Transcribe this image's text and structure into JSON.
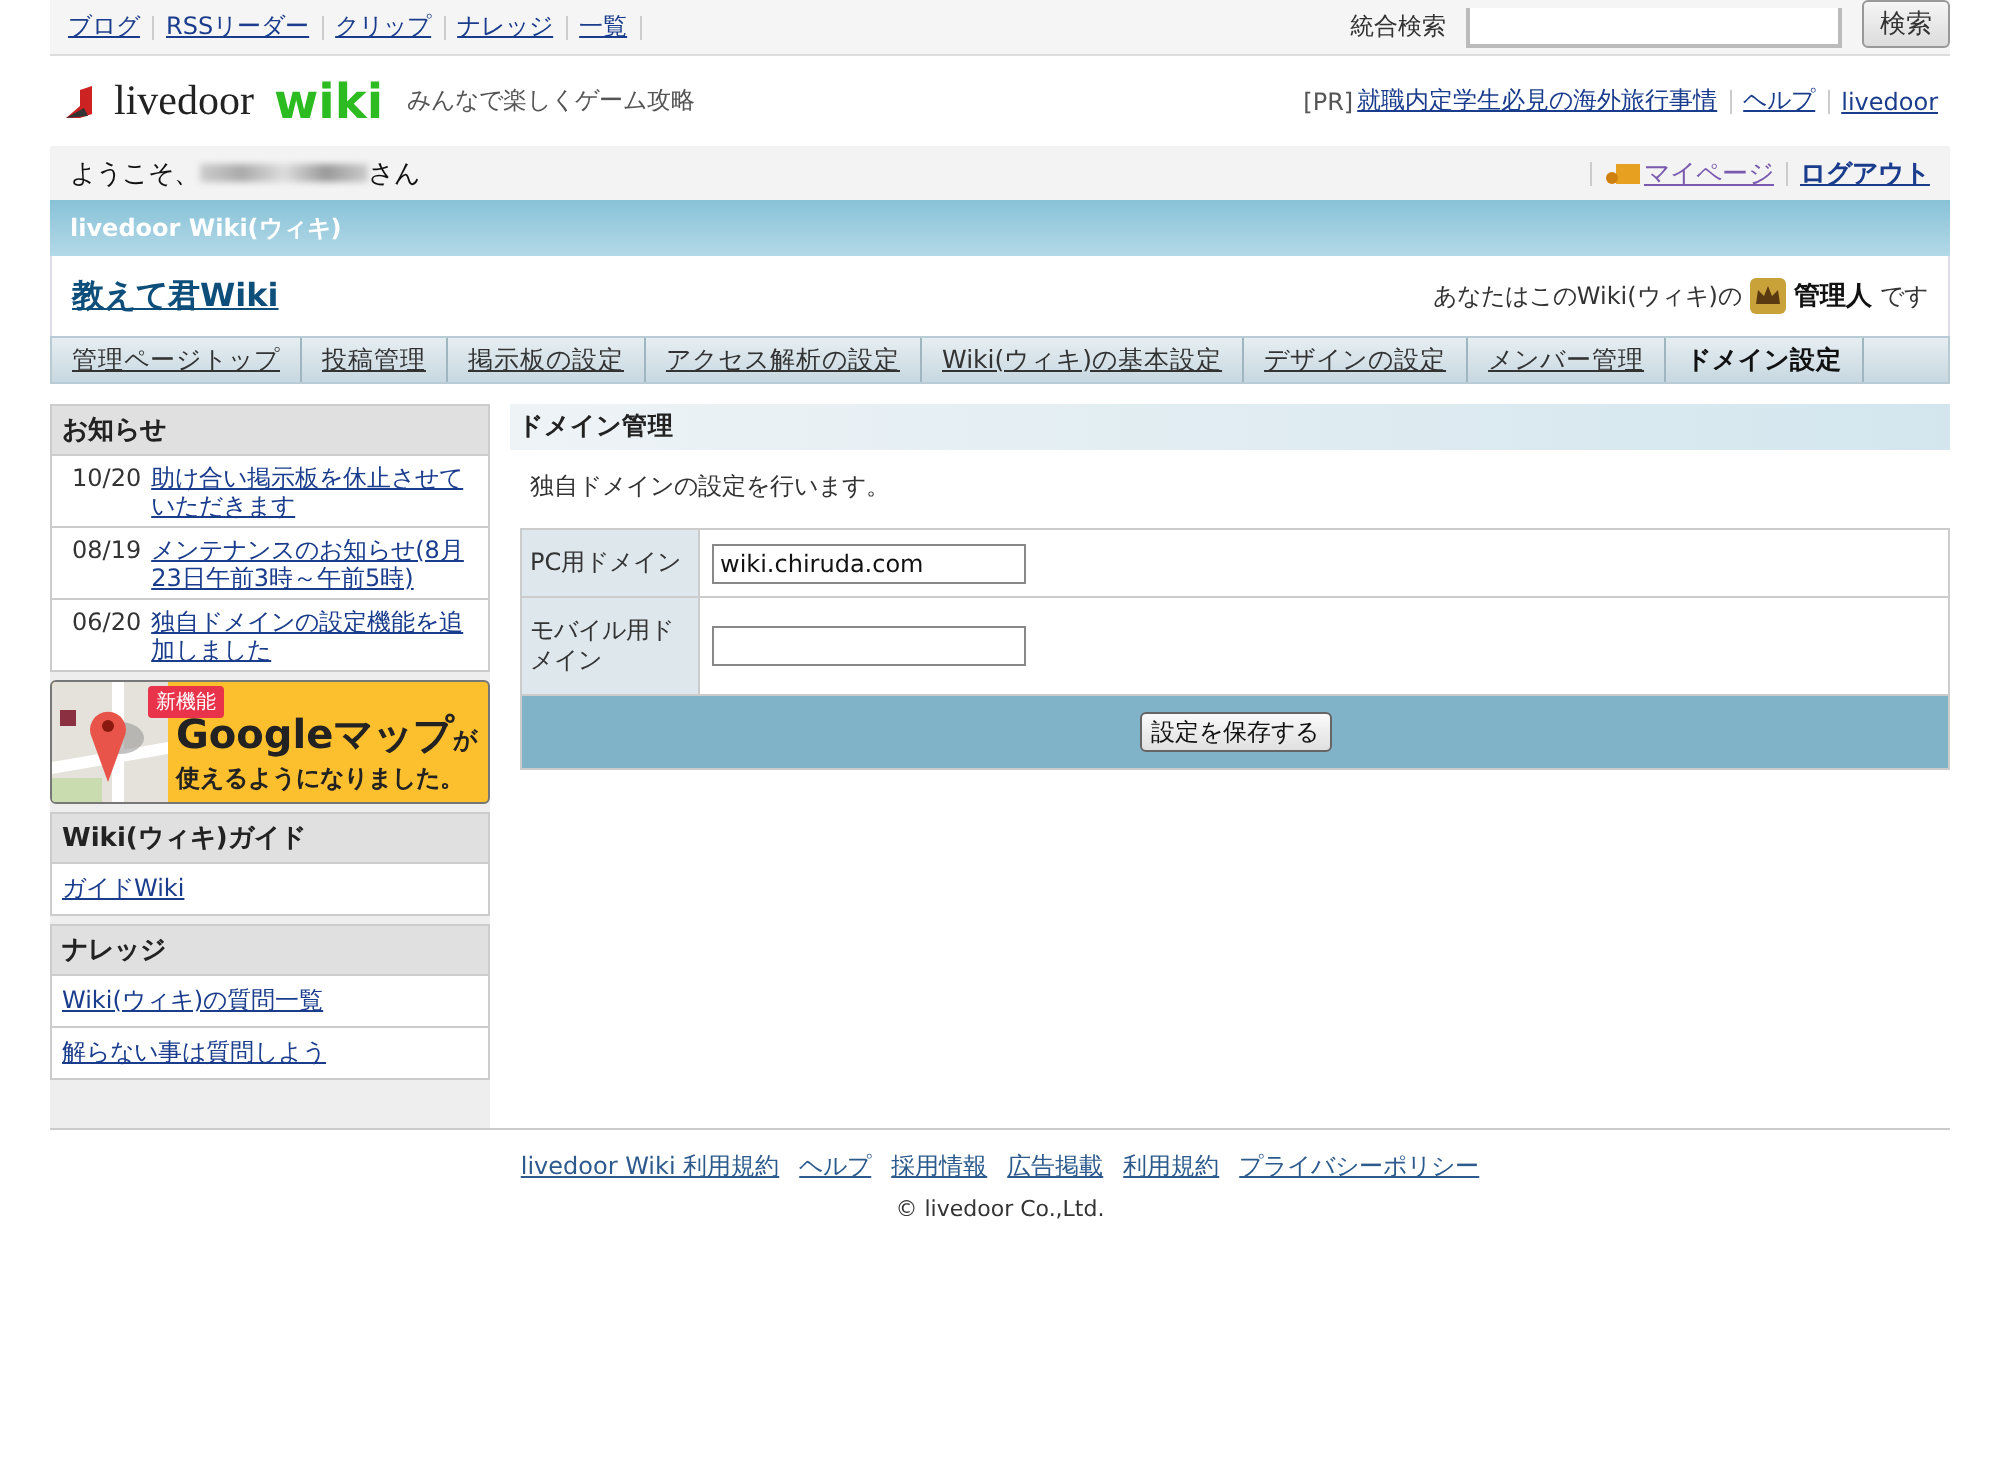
{
  "top_links": [
    "ブログ",
    "RSSリーダー",
    "クリップ",
    "ナレッジ",
    "一覧"
  ],
  "search": {
    "label": "統合検索",
    "button": "検索"
  },
  "header": {
    "logo_text": "livedoor",
    "logo_wiki": "wiki",
    "tagline": "みんなで楽しくゲーム攻略",
    "pr_label": "[PR]",
    "pr_link": "就職内定学生必見の海外旅行事情",
    "links": [
      "ヘルプ",
      "livedoor"
    ]
  },
  "welcome": {
    "before": "ようこそ、",
    "after": "さん",
    "links": [
      "マイページ",
      "ログアウト"
    ]
  },
  "service_bar": {
    "title": "livedoor Wiki(ウィキ)"
  },
  "site": {
    "title": "教えて君Wiki",
    "role_before": "あなたはこのWiki(ウィキ)の",
    "role": "管理人",
    "role_after": "です"
  },
  "tabs": [
    {
      "label": "管理ページトップ",
      "selected": false
    },
    {
      "label": "投稿管理",
      "selected": false
    },
    {
      "label": "掲示板の設定",
      "selected": false
    },
    {
      "label": "アクセス解析の設定",
      "selected": false
    },
    {
      "label": "Wiki(ウィキ)の基本設定",
      "selected": false
    },
    {
      "label": "デザインの設定",
      "selected": false
    },
    {
      "label": "メンバー管理",
      "selected": false
    },
    {
      "label": "ドメイン設定",
      "selected": true
    }
  ],
  "sidebar": {
    "news": {
      "title": "お知らせ",
      "items": [
        {
          "date": "10/20",
          "text": "助け合い掲示板を休止させていただきます"
        },
        {
          "date": "08/19",
          "text": "メンテナンスのお知らせ(8月23日午前3時～午前5時)"
        },
        {
          "date": "06/20",
          "text": "独自ドメインの設定機能を追加しました"
        }
      ]
    },
    "banner": {
      "badge": "新機能",
      "headline": "Googleマップ",
      "headline_suffix": "が",
      "subline": "使えるようになりました。"
    },
    "sections": [
      {
        "title": "Wiki(ウィキ)ガイド",
        "links": [
          "ガイドWiki"
        ]
      },
      {
        "title": "ナレッジ",
        "links": [
          "Wiki(ウィキ)の質問一覧",
          "解らない事は質問しよう"
        ]
      }
    ]
  },
  "main": {
    "title": "ドメイン管理",
    "description": "独自ドメインの設定を行います。",
    "fields": [
      {
        "label": "PC用ドメイン",
        "value": "wiki.chiruda.com"
      },
      {
        "label": "モバイル用ドメイン"
      }
    ],
    "save_button": "設定を保存する"
  },
  "footer": {
    "links": [
      "livedoor Wiki 利用規約",
      "ヘルプ",
      "採用情報",
      "広告掲載",
      "利用規約",
      "プライバシーポリシー"
    ],
    "copyright": "© livedoor Co.,Ltd."
  }
}
